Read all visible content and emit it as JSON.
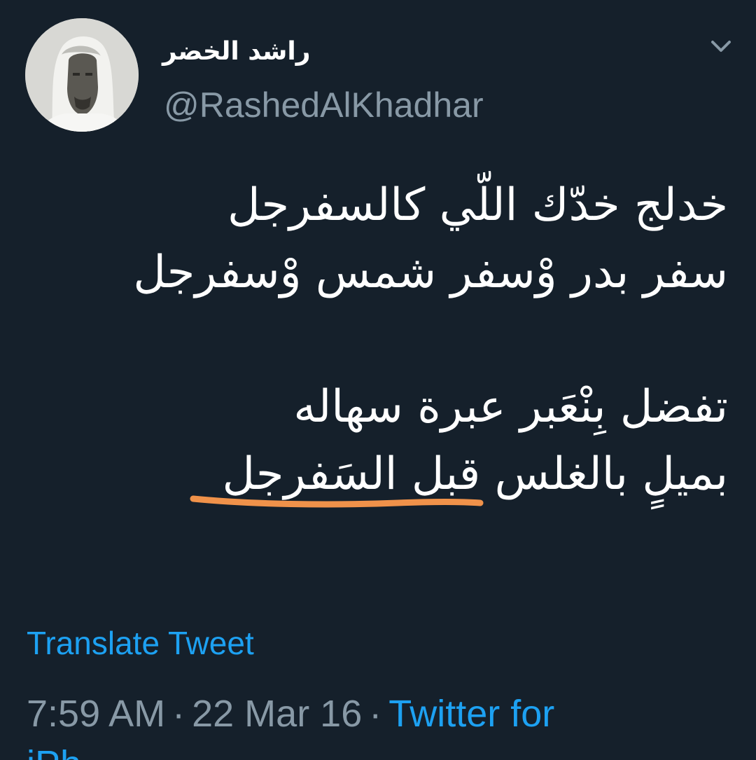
{
  "tweet": {
    "display_name": "راشد الخضر",
    "handle": "@RashedAlKhadhar",
    "lines": [
      "خدلج خدّك اللّي كالسفرجل",
      "سفر بدر وْسفر شمس وْسفرجل",
      "",
      "تفضل بِنْعَبر عبرة سهاله",
      "بميلٍ بالغلس قبل السَفرجل"
    ],
    "highlight_color": "#f0924a",
    "translate_label": "Translate Tweet",
    "time": "7:59 AM",
    "separator": "·",
    "date": "22 Mar 16",
    "source": "Twitter for",
    "source_cont": "iPh"
  },
  "icons": {
    "caret": "chevron-down-icon"
  },
  "colors": {
    "background": "#15202b",
    "text": "#ffffff",
    "muted": "#8899a6",
    "link": "#1da1f2"
  }
}
